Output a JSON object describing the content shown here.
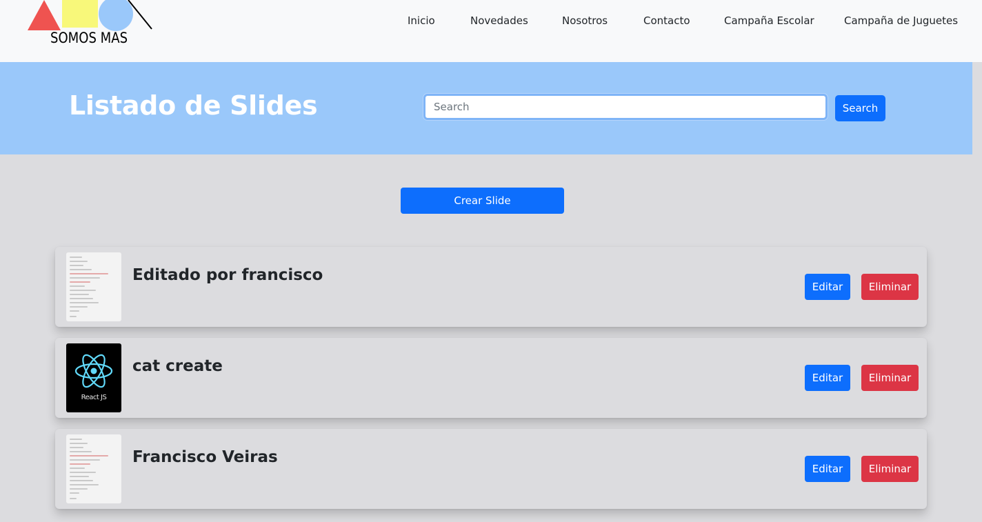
{
  "brand": {
    "logo_text": "SOMOS MAS"
  },
  "nav": {
    "items": [
      {
        "label": "Inicio"
      },
      {
        "label": "Novedades"
      },
      {
        "label": "Nosotros"
      },
      {
        "label": "Contacto"
      },
      {
        "label": "Campaña Escolar"
      },
      {
        "label": "Campaña de Juguetes"
      }
    ]
  },
  "hero": {
    "title": "Listado de Slides",
    "search_placeholder": "Search",
    "search_value": "",
    "search_button": "Search"
  },
  "actions": {
    "create_label": "Crear Slide"
  },
  "slides": [
    {
      "title": "Editado por francisco",
      "thumbnail": "code-screenshot",
      "edit_label": "Editar",
      "delete_label": "Eliminar"
    },
    {
      "title": "cat create",
      "thumbnail": "react-logo",
      "thumbnail_caption": "React JS",
      "edit_label": "Editar",
      "delete_label": "Eliminar"
    },
    {
      "title": "Francisco Veiras",
      "thumbnail": "code-screenshot",
      "edit_label": "Editar",
      "delete_label": "Eliminar"
    }
  ],
  "colors": {
    "navbar_bg": "#f8f9fa",
    "hero_bg": "#9ac8fa",
    "page_bg": "#dcdcdf",
    "primary": "#0d6efd",
    "danger": "#dc3545",
    "logo_red": "#ef5350",
    "logo_yellow": "#f8f87a",
    "logo_blue": "#9ac8fa"
  }
}
